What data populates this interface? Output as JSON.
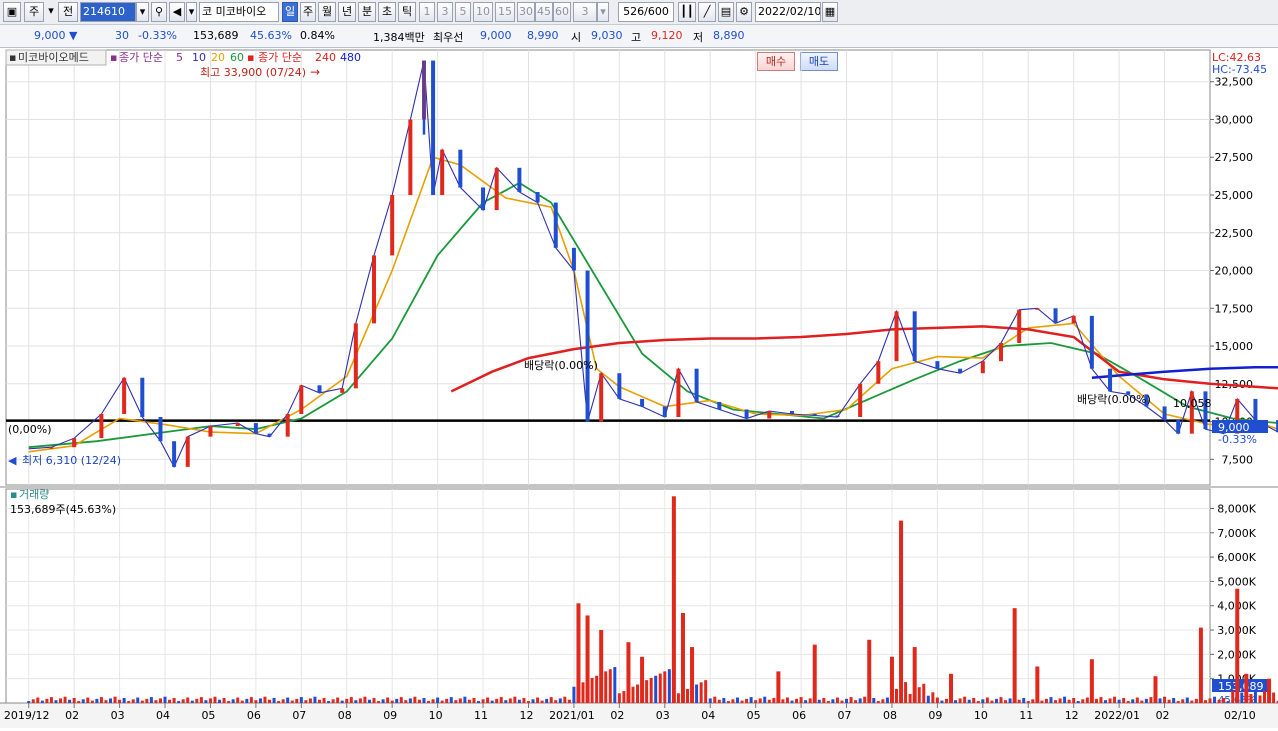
{
  "toolbar": {
    "period_unit": "주",
    "prev_label": "전",
    "code": "214610",
    "market_badge": "코",
    "stock_name": "미코바이오",
    "periods": [
      "일",
      "주",
      "월",
      "년",
      "분",
      "초",
      "틱"
    ],
    "selected_period": "일",
    "intervals": [
      "1",
      "3",
      "5",
      "10",
      "15",
      "30",
      "45",
      "60"
    ],
    "interval_select": "3",
    "count": "526",
    "count_max": "/600",
    "date": "2022/02/10"
  },
  "quote": {
    "price": "9,000",
    "change": "30",
    "change_rate": "-0.33%",
    "volume": "153,689",
    "volume_ratio": "45.63%",
    "turnover": "0.84%",
    "amount": "1,384백만",
    "priority_label": "최우선",
    "ask": "9,000",
    "bid": "8,990",
    "open_label": "시",
    "open": "9,030",
    "high_label": "고",
    "high": "9,120",
    "low_label": "저",
    "low": "8,890",
    "buy_label": "매수",
    "sell_label": "매도"
  },
  "legend": {
    "name": "미코바이오메드",
    "ma_short_label": "종가 단순",
    "ma_5": "5",
    "ma_10": "10",
    "ma_20": "20",
    "ma_60": "60",
    "ma_long_label": "종가 단순",
    "ma_240": "240",
    "ma_480": "480",
    "lc": "LC:42.63",
    "hc": "HC:-73.45"
  },
  "annotations": {
    "max_label": "최고 33,900 (07/24)",
    "min_label": "최저 6,310 (12/24)",
    "div1": "배당락(0.00%)",
    "div2": "배당락(0.00%)",
    "div0": "(0,00%)",
    "hline_value": "10,058",
    "last_price": "9,000",
    "last_change": "-0.33%"
  },
  "volume_panel": {
    "title": "거래량",
    "subtitle": "153,689주(45.63%)",
    "last_volume": "153,689",
    "last_ratio": "45.63%"
  },
  "colors": {
    "up": "#e0281c",
    "down": "#1f4fd0",
    "ma5": "#8b2f8f",
    "ma10": "#2f2fb0",
    "ma20": "#e6a000",
    "ma60": "#1a9a3a",
    "ma240": "#e02020",
    "ma480": "#1020d0",
    "hline": "#000000"
  },
  "chart_data": {
    "type": "line",
    "title": "미코바이오메드",
    "x_ticks": [
      "2019/12",
      "02",
      "03",
      "04",
      "05",
      "06",
      "07",
      "08",
      "09",
      "10",
      "11",
      "12",
      "2021/01",
      "02",
      "03",
      "04",
      "05",
      "06",
      "07",
      "08",
      "09",
      "10",
      "11",
      "12",
      "2022/01",
      "02"
    ],
    "x_end_label": "02/10",
    "price_axis": {
      "ticks": [
        7500,
        10000,
        12500,
        15000,
        17500,
        20000,
        22500,
        25000,
        27500,
        30000,
        32500
      ],
      "ylim": [
        5800,
        34600
      ]
    },
    "volume_axis": {
      "ticks_k": [
        1000,
        2000,
        3000,
        4000,
        5000,
        6000,
        7000,
        8000
      ],
      "ylim_k": [
        0,
        8800
      ]
    },
    "close_path": [
      [
        0,
        8200
      ],
      [
        0.5,
        8300
      ],
      [
        1,
        8900
      ],
      [
        1.6,
        10500
      ],
      [
        2.1,
        12900
      ],
      [
        2.5,
        10300
      ],
      [
        2.9,
        8700
      ],
      [
        3.2,
        7000
      ],
      [
        3.5,
        9000
      ],
      [
        4,
        9700
      ],
      [
        4.6,
        9900
      ],
      [
        5,
        9200
      ],
      [
        5.3,
        9000
      ],
      [
        5.7,
        10500
      ],
      [
        6,
        12400
      ],
      [
        6.4,
        11900
      ],
      [
        6.9,
        12200
      ],
      [
        7.2,
        16500
      ],
      [
        7.6,
        21000
      ],
      [
        8,
        25000
      ],
      [
        8.4,
        30000
      ],
      [
        8.7,
        33900
      ],
      [
        8.9,
        25000
      ],
      [
        9.1,
        28000
      ],
      [
        9.5,
        25500
      ],
      [
        10,
        24000
      ],
      [
        10.3,
        26800
      ],
      [
        10.8,
        25200
      ],
      [
        11.2,
        24500
      ],
      [
        11.6,
        21500
      ],
      [
        12,
        20000
      ],
      [
        12.3,
        10000
      ],
      [
        12.6,
        13200
      ],
      [
        13,
        11500
      ],
      [
        13.5,
        11000
      ],
      [
        14,
        10300
      ],
      [
        14.3,
        13500
      ],
      [
        14.7,
        11300
      ],
      [
        15.2,
        10800
      ],
      [
        15.8,
        10200
      ],
      [
        16.3,
        10700
      ],
      [
        16.8,
        10500
      ],
      [
        17.3,
        10400
      ],
      [
        17.8,
        10300
      ],
      [
        18.3,
        12500
      ],
      [
        18.7,
        14000
      ],
      [
        19.1,
        17300
      ],
      [
        19.5,
        14000
      ],
      [
        20,
        13500
      ],
      [
        20.5,
        13200
      ],
      [
        21,
        14000
      ],
      [
        21.4,
        15200
      ],
      [
        21.8,
        17400
      ],
      [
        22.2,
        17500
      ],
      [
        22.6,
        16500
      ],
      [
        23,
        17000
      ],
      [
        23.4,
        13500
      ],
      [
        23.8,
        12000
      ],
      [
        24.2,
        11800
      ],
      [
        24.6,
        11000
      ],
      [
        25,
        10100
      ],
      [
        25.3,
        9200
      ],
      [
        25.6,
        12000
      ],
      [
        25.9,
        9500
      ],
      [
        26.3,
        9200
      ],
      [
        26.6,
        11500
      ],
      [
        27,
        10100
      ],
      [
        27.5,
        9300
      ],
      [
        28,
        8900
      ],
      [
        28.3,
        8300
      ],
      [
        28.6,
        7200
      ],
      [
        28.9,
        9800
      ],
      [
        29.1,
        9000
      ]
    ],
    "ma20_path": [
      [
        0,
        8000
      ],
      [
        1,
        8400
      ],
      [
        2,
        10200
      ],
      [
        3,
        9800
      ],
      [
        4,
        9300
      ],
      [
        5,
        9200
      ],
      [
        6,
        10800
      ],
      [
        7,
        13000
      ],
      [
        8,
        20000
      ],
      [
        8.9,
        27500
      ],
      [
        9.5,
        27000
      ],
      [
        10.5,
        24800
      ],
      [
        11.5,
        24200
      ],
      [
        12,
        20000
      ],
      [
        12.5,
        13500
      ],
      [
        13,
        12300
      ],
      [
        14,
        11000
      ],
      [
        15,
        11400
      ],
      [
        16,
        10500
      ],
      [
        17,
        10400
      ],
      [
        18,
        10800
      ],
      [
        19,
        13500
      ],
      [
        20,
        14300
      ],
      [
        21,
        14200
      ],
      [
        22,
        16200
      ],
      [
        23,
        16500
      ],
      [
        24,
        13000
      ],
      [
        25,
        10500
      ],
      [
        26,
        9800
      ],
      [
        27,
        10000
      ],
      [
        28,
        9000
      ],
      [
        28.7,
        8400
      ],
      [
        29.1,
        8600
      ]
    ],
    "ma60_path": [
      [
        0,
        8300
      ],
      [
        1.5,
        8700
      ],
      [
        3,
        9300
      ],
      [
        4,
        9700
      ],
      [
        5,
        9500
      ],
      [
        6,
        10200
      ],
      [
        7,
        12000
      ],
      [
        8,
        15500
      ],
      [
        9,
        21000
      ],
      [
        10,
        24500
      ],
      [
        10.8,
        25800
      ],
      [
        11.5,
        24500
      ],
      [
        12.5,
        19500
      ],
      [
        13.5,
        14500
      ],
      [
        14.5,
        12000
      ],
      [
        15.5,
        10800
      ],
      [
        16.5,
        10500
      ],
      [
        17.5,
        10200
      ],
      [
        18.5,
        11500
      ],
      [
        19.5,
        12800
      ],
      [
        20.5,
        14000
      ],
      [
        21.5,
        15000
      ],
      [
        22.5,
        15200
      ],
      [
        23.5,
        14500
      ],
      [
        24.5,
        12800
      ],
      [
        25.5,
        11000
      ],
      [
        26.5,
        10200
      ],
      [
        27.5,
        9900
      ],
      [
        28.5,
        9200
      ],
      [
        29.1,
        9000
      ]
    ],
    "ma240_path": [
      [
        9.3,
        12000
      ],
      [
        10.2,
        13300
      ],
      [
        11,
        14200
      ],
      [
        12,
        14800
      ],
      [
        13,
        15200
      ],
      [
        14,
        15400
      ],
      [
        15,
        15500
      ],
      [
        16,
        15500
      ],
      [
        17,
        15600
      ],
      [
        18,
        15800
      ],
      [
        19,
        16100
      ],
      [
        20,
        16200
      ],
      [
        21,
        16300
      ],
      [
        22,
        16100
      ],
      [
        23,
        15600
      ],
      [
        24,
        13300
      ],
      [
        25,
        12800
      ],
      [
        26,
        12500
      ],
      [
        27,
        12300
      ],
      [
        28,
        12100
      ],
      [
        29,
        11900
      ]
    ],
    "ma480_path": [
      [
        23.4,
        12900
      ],
      [
        25,
        13300
      ],
      [
        26,
        13500
      ],
      [
        27,
        13600
      ],
      [
        28,
        13600
      ],
      [
        29,
        13600
      ]
    ],
    "resistance_line": 10058,
    "max_price": 33900,
    "min_price": 6310,
    "volume_spikes_k": [
      [
        12.1,
        4100,
        "up"
      ],
      [
        12.3,
        3600,
        "up"
      ],
      [
        12.6,
        3000,
        "up"
      ],
      [
        13.2,
        2500,
        "up"
      ],
      [
        13.5,
        1900,
        "up"
      ],
      [
        14.2,
        8500,
        "up"
      ],
      [
        14.4,
        3700,
        "up"
      ],
      [
        14.6,
        2300,
        "up"
      ],
      [
        16.5,
        1300,
        "up"
      ],
      [
        17.3,
        2400,
        "up"
      ],
      [
        18.5,
        2600,
        "up"
      ],
      [
        19,
        1900,
        "up"
      ],
      [
        19.2,
        7500,
        "up"
      ],
      [
        19.5,
        2300,
        "up"
      ],
      [
        20.3,
        1200,
        "up"
      ],
      [
        21.7,
        3900,
        "up"
      ],
      [
        22.2,
        1500,
        "up"
      ],
      [
        23.4,
        1800,
        "up"
      ],
      [
        24.8,
        1100,
        "up"
      ],
      [
        25.8,
        3100,
        "up"
      ],
      [
        26.6,
        4700,
        "up"
      ],
      [
        26.8,
        1200,
        "up"
      ],
      [
        27.3,
        1000,
        "up"
      ],
      [
        28.7,
        1300,
        "up"
      ],
      [
        28.85,
        6100,
        "up"
      ],
      [
        29,
        1000,
        "down"
      ]
    ]
  }
}
